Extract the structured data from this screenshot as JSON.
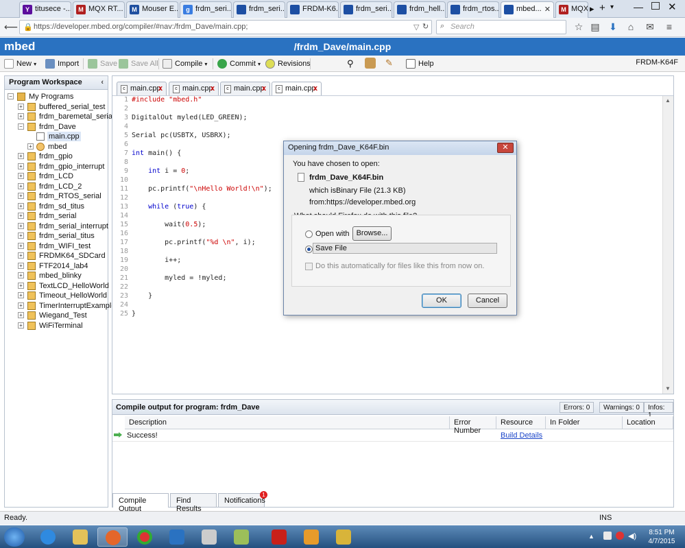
{
  "browser": {
    "tabs": [
      {
        "label": "titusece -...",
        "icon": "yahoo-icon",
        "color": "#5c0f9d"
      },
      {
        "label": "MQX RT...",
        "icon": "mqx-icon",
        "color": "#b02020"
      },
      {
        "label": "Mouser E...",
        "icon": "mouser-icon",
        "color": "#2050a0"
      },
      {
        "label": "frdm_seri...",
        "icon": "google-icon",
        "color": "#3a7de1"
      },
      {
        "label": "frdm_seri...",
        "icon": "page-icon",
        "color": "#1d4fa3"
      },
      {
        "label": "FRDM-K6...",
        "icon": "page-icon",
        "color": "#1d4fa3"
      },
      {
        "label": "frdm_seri...",
        "icon": "page-icon",
        "color": "#1d4fa3"
      },
      {
        "label": "frdm_hell...",
        "icon": "page-icon",
        "color": "#1d4fa3"
      },
      {
        "label": "frdm_rtos...",
        "icon": "page-icon",
        "color": "#1d4fa3"
      },
      {
        "label": "mbed...",
        "icon": "page-icon",
        "color": "#1d4fa3"
      },
      {
        "label": "MQX",
        "icon": "mqx-icon",
        "color": "#b02020"
      }
    ],
    "url": "https://developer.mbed.org/compiler/#nav:/frdm_Dave/main.cpp;",
    "search_placeholder": "Search"
  },
  "mbed": {
    "logo": "mbed",
    "path_title": "/frdm_Dave/main.cpp",
    "platform": "FRDM-K64F"
  },
  "toolbar": {
    "new": "New",
    "import": "Import",
    "save": "Save",
    "save_all": "Save All",
    "compile": "Compile",
    "commit": "Commit",
    "revisions": "Revisions",
    "help": "Help"
  },
  "workspace": {
    "title": "Program Workspace",
    "root": "My Programs",
    "programs": [
      "buffered_serial_test",
      "frdm_baremetal_serial",
      "frdm_Dave",
      "main.cpp",
      "mbed",
      "frdm_gpio",
      "frdm_gpio_interrupt",
      "frdm_LCD",
      "frdm_LCD_2",
      "frdm_RTOS_serial",
      "frdm_sd_titus",
      "frdm_serial",
      "frdm_serial_interrupt",
      "frdm_serial_titus",
      "frdm_WIFI_test",
      "FRDMK64_SDCard",
      "FTF2014_lab4",
      "mbed_blinky",
      "TextLCD_HelloWorld",
      "Timeout_HelloWorld",
      "TimerInterruptExample",
      "Wiegand_Test",
      "WiFiTerminal"
    ]
  },
  "editor": {
    "tabs": [
      "main.cpp",
      "main.cpp",
      "main.cpp",
      "main.cpp"
    ],
    "line_numbers": [
      "1",
      "2",
      "3",
      "4",
      "5",
      "6",
      "7",
      "8",
      "9",
      "10",
      "11",
      "12",
      "13",
      "14",
      "15",
      "16",
      "17",
      "18",
      "19",
      "20",
      "21",
      "22",
      "23",
      "24",
      "25"
    ]
  },
  "output": {
    "title": "Compile output for program: frdm_Dave",
    "errors": "Errors: 0",
    "warnings": "Warnings: 0",
    "infos": "Infos: 1",
    "columns": [
      "Description",
      "Error Number",
      "Resource",
      "In Folder",
      "Location"
    ],
    "row": {
      "description": "Success!",
      "resource": "Build Details"
    },
    "tabs": [
      "Compile Output",
      "Find Results",
      "Notifications"
    ],
    "notification_count": "1"
  },
  "status": {
    "text": "Ready.",
    "mode": "INS"
  },
  "dialog": {
    "title": "Opening frdm_Dave_K64F.bin",
    "chosen": "You have chosen to open:",
    "filename": "frdm_Dave_K64F.bin",
    "which_is_label": "which is:",
    "which_is": "Binary File (21.3 KB)",
    "from_label": "from:",
    "from": "https://developer.mbed.org",
    "question": "What should Firefox do with this file?",
    "open_with": "Open with",
    "browse": "Browse...",
    "save_file": "Save File",
    "auto": "Do this automatically for files like this from now on.",
    "ok": "OK",
    "cancel": "Cancel"
  },
  "taskbar": {
    "time": "8:51 PM",
    "date": "4/7/2015"
  }
}
